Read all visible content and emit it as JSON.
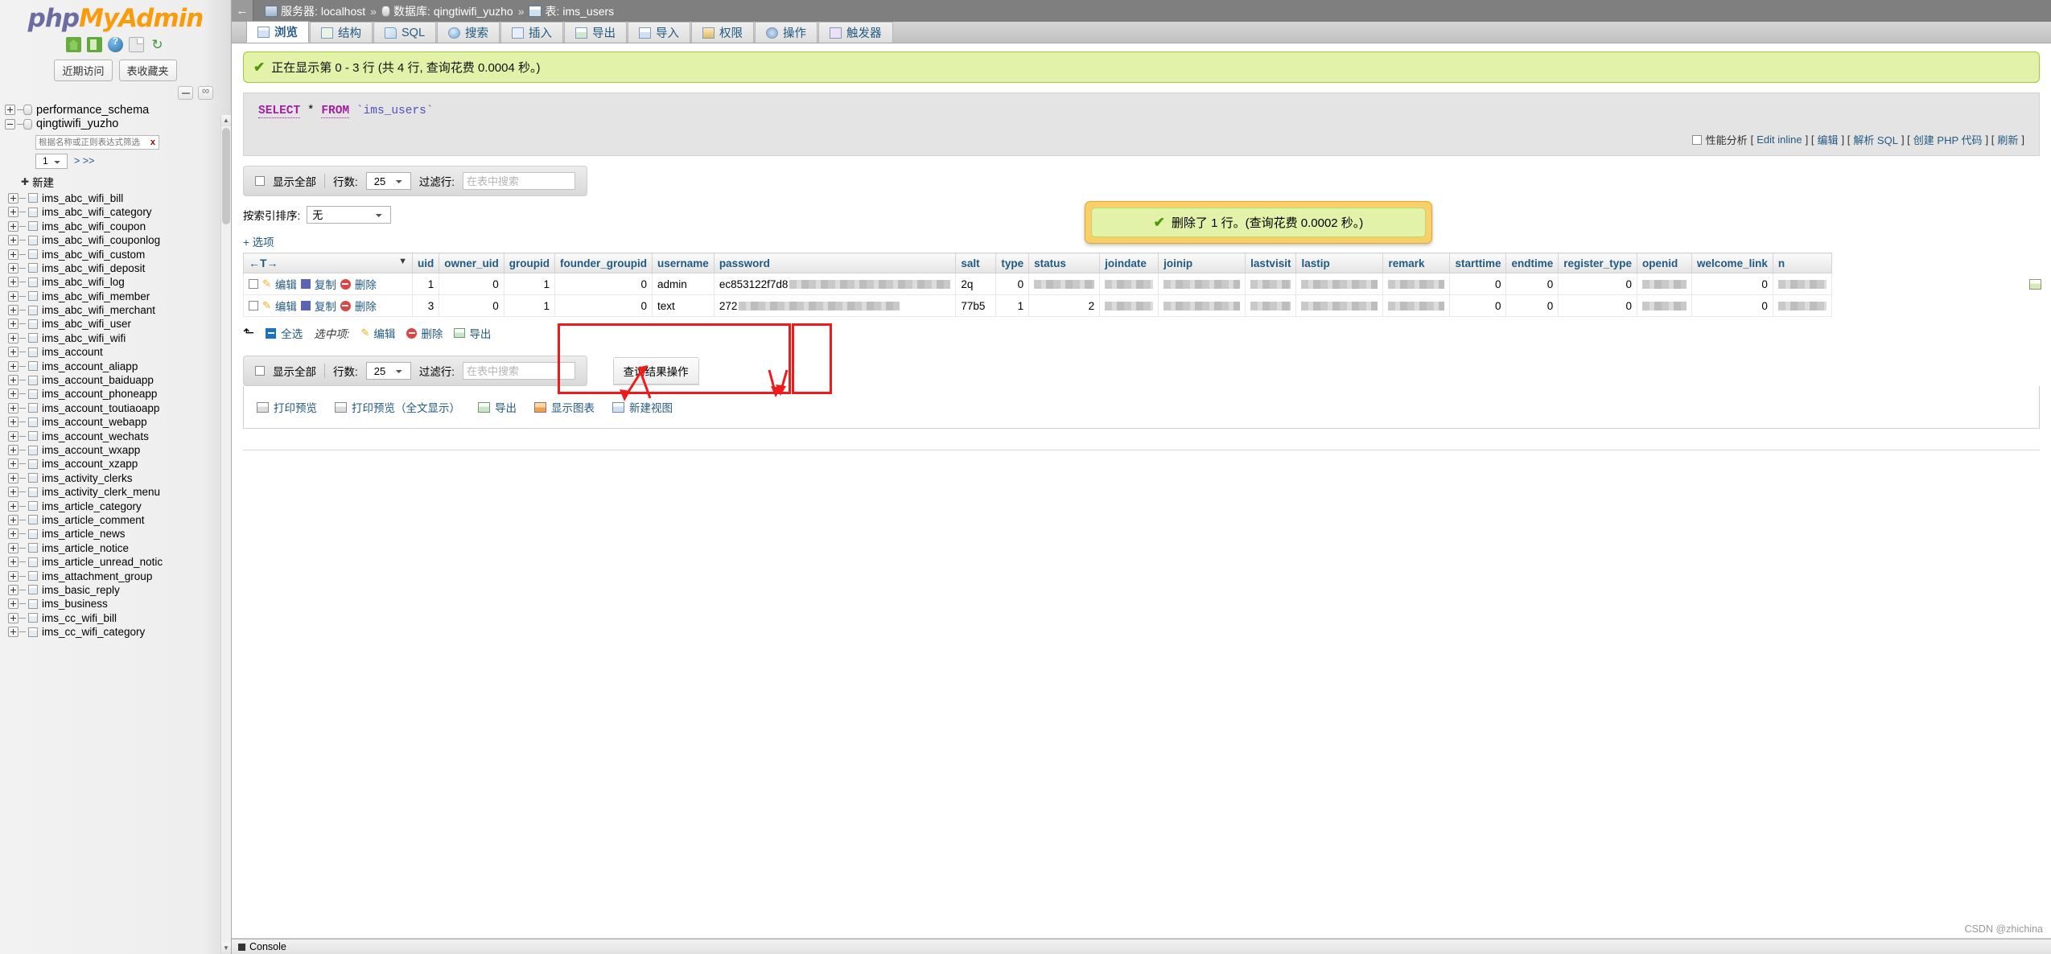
{
  "sidebar": {
    "logo": {
      "php": "php",
      "my": "My",
      "admin": "Admin"
    },
    "icons": [
      {
        "name": "home-icon",
        "title": "主页"
      },
      {
        "name": "logout-icon",
        "title": "退出"
      },
      {
        "name": "help-icon",
        "title": "帮助"
      },
      {
        "name": "docs-icon",
        "title": "文档"
      },
      {
        "name": "reload-icon",
        "title": "重新加载"
      }
    ],
    "chips": [
      {
        "label": "近期访问"
      },
      {
        "label": "表收藏夹"
      }
    ],
    "mini_buttons": [
      {
        "name": "collapse-tree-button"
      },
      {
        "name": "toggle-link-button"
      }
    ],
    "databases": [
      {
        "label": "performance_schema",
        "expanded": false
      },
      {
        "label": "qingtiwifi_yuzho",
        "expanded": true
      }
    ],
    "filter": {
      "placeholder": "根据名称或正则表达式筛选",
      "value": "",
      "clear_label": "x"
    },
    "page_select": "1",
    "page_next": "> >>",
    "new_label": "新建",
    "tables": [
      "ims_abc_wifi_bill",
      "ims_abc_wifi_category",
      "ims_abc_wifi_coupon",
      "ims_abc_wifi_couponlog",
      "ims_abc_wifi_custom",
      "ims_abc_wifi_deposit",
      "ims_abc_wifi_log",
      "ims_abc_wifi_member",
      "ims_abc_wifi_merchant",
      "ims_abc_wifi_user",
      "ims_abc_wifi_wifi",
      "ims_account",
      "ims_account_aliapp",
      "ims_account_baiduapp",
      "ims_account_phoneapp",
      "ims_account_toutiaoapp",
      "ims_account_webapp",
      "ims_account_wechats",
      "ims_account_wxapp",
      "ims_account_xzapp",
      "ims_activity_clerks",
      "ims_activity_clerk_menu",
      "ims_article_category",
      "ims_article_comment",
      "ims_article_news",
      "ims_article_notice",
      "ims_article_unread_notic",
      "ims_attachment_group",
      "ims_basic_reply",
      "ims_business",
      "ims_cc_wifi_bill",
      "ims_cc_wifi_category"
    ]
  },
  "topbar": {
    "back_label": "←",
    "breadcrumb": {
      "server_label": "服务器:",
      "server_value": "localhost",
      "db_label": "数据库:",
      "db_value": "qingtiwifi_yuzho",
      "table_label": "表:",
      "table_value": "ims_users",
      "separator": "»"
    }
  },
  "tabs": [
    {
      "label": "浏览",
      "icon": "browse-icon",
      "active": true
    },
    {
      "label": "结构",
      "icon": "structure-icon",
      "active": false
    },
    {
      "label": "SQL",
      "icon": "sql-icon",
      "active": false
    },
    {
      "label": "搜索",
      "icon": "search-icon",
      "active": false
    },
    {
      "label": "插入",
      "icon": "insert-icon",
      "active": false
    },
    {
      "label": "导出",
      "icon": "export-icon",
      "active": false
    },
    {
      "label": "导入",
      "icon": "import-icon",
      "active": false
    },
    {
      "label": "权限",
      "icon": "privileges-icon",
      "active": false
    },
    {
      "label": "操作",
      "icon": "operations-icon",
      "active": false
    },
    {
      "label": "触发器",
      "icon": "triggers-icon",
      "active": false
    }
  ],
  "alert": {
    "text": "正在显示第 0 - 3 行 (共 4 行, 查询花费 0.0004 秒。)"
  },
  "sql": {
    "keyword_select": "SELECT",
    "star": "*",
    "keyword_from": "FROM",
    "table": "`ims_users`",
    "profiling_label": "性能分析",
    "links": [
      {
        "label": "Edit inline"
      },
      {
        "label": "编辑"
      },
      {
        "label": "解析 SQL"
      },
      {
        "label": "创建 PHP 代码"
      },
      {
        "label": "刷新"
      }
    ]
  },
  "toolbar_top": {
    "show_all_label": "显示全部",
    "rows_label": "行数:",
    "rows_value": "25",
    "filter_label": "过滤行:",
    "filter_placeholder": "在表中搜索",
    "filter_value": ""
  },
  "sort": {
    "label": "按索引排序:",
    "value": "无"
  },
  "options_link": "+ 选项",
  "table": {
    "nav_arrows": "←T→",
    "sort_caret": "▼",
    "columns": [
      "uid",
      "owner_uid",
      "groupid",
      "founder_groupid",
      "username",
      "password",
      "salt",
      "type",
      "status",
      "joindate",
      "joinip",
      "lastvisit",
      "lastip",
      "remark",
      "starttime",
      "endtime",
      "register_type",
      "openid",
      "welcome_link",
      "n"
    ],
    "row_actions": {
      "edit": "编辑",
      "copy": "复制",
      "delete": "删除"
    },
    "rows": [
      {
        "uid": "1",
        "owner_uid": "0",
        "groupid": "1",
        "founder_groupid": "0",
        "username": "admin",
        "password": "ec853122f7d8",
        "salt": "2q",
        "type": "0",
        "status": "",
        "joindate": "",
        "joinip": "",
        "lastvisit": "",
        "lastip": "",
        "remark": "",
        "starttime": "0",
        "endtime": "0",
        "register_type": "0",
        "openid": "",
        "welcome_link": "0"
      },
      {
        "uid": "3",
        "owner_uid": "0",
        "groupid": "1",
        "founder_groupid": "0",
        "username": "text",
        "password": "272",
        "salt": "77b5",
        "type": "1",
        "status": "2",
        "joindate": "",
        "joinip": "",
        "lastvisit": "",
        "lastip": "",
        "remark": "",
        "starttime": "0",
        "endtime": "0",
        "register_type": "0",
        "openid": "",
        "welcome_link": "0"
      }
    ]
  },
  "table_footer": {
    "select_all": "全选",
    "with_selected": "选中项:",
    "edit": "编辑",
    "delete": "删除",
    "export": "导出"
  },
  "toolbar_bottom": {
    "show_all_label": "显示全部",
    "rows_label": "行数:",
    "rows_value": "25",
    "filter_label": "过滤行:",
    "filter_placeholder": "在表中搜索",
    "filter_value": ""
  },
  "query_results": {
    "title": "查询结果操作",
    "actions": [
      {
        "label": "打印预览",
        "icon": "print-icon"
      },
      {
        "label": "打印预览（全文显示）",
        "icon": "print-full-icon"
      },
      {
        "label": "导出",
        "icon": "export-icon"
      },
      {
        "label": "显示图表",
        "icon": "chart-icon"
      },
      {
        "label": "新建视图",
        "icon": "view-icon"
      }
    ]
  },
  "delete_toast": {
    "text": "删除了 1 行。(查询花费 0.0002 秒。)"
  },
  "console": {
    "label": "Console"
  },
  "watermark": "CSDN @zhichina",
  "colors": {
    "accent_blue": "#235a81",
    "alert_green_bg": "#e2f2a8",
    "alert_green_border": "#a4c639",
    "toast_orange": "#f8cf69",
    "annotation_red": "#ee1b1b",
    "topbar_gray": "#7f7f7f"
  }
}
